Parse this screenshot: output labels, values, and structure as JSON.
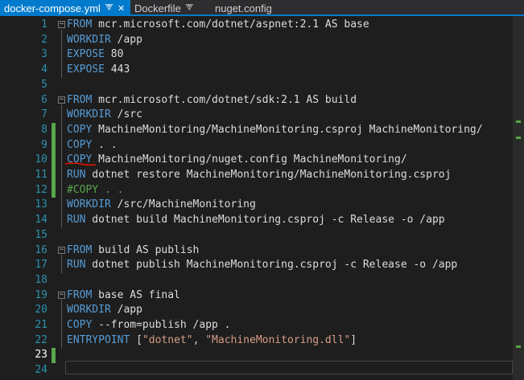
{
  "tabs": [
    {
      "label": "docker-compose.yml",
      "active": true
    },
    {
      "label": "Dockerfile",
      "active": false
    },
    {
      "label": "nuget.config",
      "active": false
    }
  ],
  "icons": {
    "pin": "pin-icon",
    "close": "close-icon",
    "fold": "fold-toggle-icon"
  },
  "colors": {
    "keyword": "#569cd6",
    "comment": "#57a64a",
    "string": "#d69d85",
    "line_number": "#2b91af",
    "accent": "#007acc",
    "changed_marker": "#57a64a",
    "error_squiggle": "#e51400"
  },
  "lines": [
    {
      "n": "1",
      "kw": "FROM",
      "rest": " mcr.microsoft.com/dotnet/aspnet:2.1 AS base"
    },
    {
      "n": "2",
      "kw": "WORKDIR",
      "rest": " /app"
    },
    {
      "n": "3",
      "kw": "EXPOSE",
      "rest": " 80"
    },
    {
      "n": "4",
      "kw": "EXPOSE",
      "rest": " 443"
    },
    {
      "n": "5",
      "kw": "",
      "rest": ""
    },
    {
      "n": "6",
      "kw": "FROM",
      "rest": " mcr.microsoft.com/dotnet/sdk:2.1 AS build"
    },
    {
      "n": "7",
      "kw": "WORKDIR",
      "rest": " /src"
    },
    {
      "n": "8",
      "kw": "COPY",
      "rest": " MachineMonitoring/MachineMonitoring.csproj MachineMonitoring/"
    },
    {
      "n": "9",
      "kw": "COPY",
      "rest": " . ."
    },
    {
      "n": "10",
      "kw": "COPY",
      "rest": " MachineMonitoring/nuget.config MachineMonitoring/"
    },
    {
      "n": "11",
      "kw": "RUN",
      "rest": " dotnet restore MachineMonitoring/MachineMonitoring.csproj"
    },
    {
      "n": "12",
      "comment": "#COPY . ."
    },
    {
      "n": "13",
      "kw": "WORKDIR",
      "rest": " /src/MachineMonitoring"
    },
    {
      "n": "14",
      "kw": "RUN",
      "rest": " dotnet build MachineMonitoring.csproj -c Release -o /app"
    },
    {
      "n": "15",
      "kw": "",
      "rest": ""
    },
    {
      "n": "16",
      "kw": "FROM",
      "rest": " build AS publish"
    },
    {
      "n": "17",
      "kw": "RUN",
      "rest": " dotnet publish MachineMonitoring.csproj -c Release -o /app"
    },
    {
      "n": "18",
      "kw": "",
      "rest": ""
    },
    {
      "n": "19",
      "kw": "FROM",
      "rest": " base AS final"
    },
    {
      "n": "20",
      "kw": "WORKDIR",
      "rest": " /app"
    },
    {
      "n": "21",
      "kw": "COPY",
      "rest": " --from=publish /app ."
    },
    {
      "n": "22",
      "kw": "ENTRYPOINT",
      "rest": " [",
      "s1": "\"dotnet\"",
      "mid": ", ",
      "s2": "\"MachineMonitoring.dll\"",
      "end": "]"
    },
    {
      "n": "23",
      "kw": "",
      "rest": ""
    },
    {
      "n": "24",
      "kw": "",
      "rest": ""
    }
  ]
}
